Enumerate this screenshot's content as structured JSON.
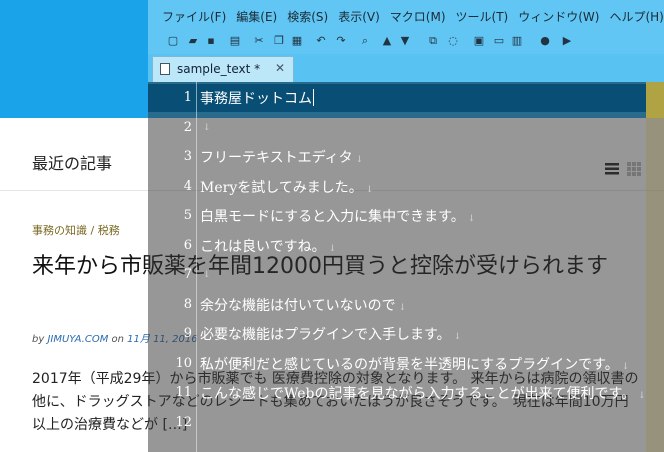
{
  "background_page": {
    "recent_heading": "最近の記事",
    "category": "事務の知識 / 税務",
    "post_title": "来年から市販薬を年間12000円買うと控除が受けられます",
    "meta_prefix": "by",
    "meta_author": "JIMUYA.COM",
    "meta_mid": "on",
    "meta_date": "11月 11, 2016",
    "excerpt": "2017年（平成29年）から市販薬でも 医療費控除の対象となります。 来年からは病院の領収書の他に、ドラッグストアなどのレシートも集めておいたほうが良さそうです。　現在は年間10万円以上の治療費などが […]",
    "header_color": "#1aa3e8"
  },
  "editor": {
    "menu": [
      "ファイル(F)",
      "編集(E)",
      "検索(S)",
      "表示(V)",
      "マクロ(M)",
      "ツール(T)",
      "ウィンドウ(W)",
      "ヘルプ(H)"
    ],
    "toolbar_icons": [
      "new-icon",
      "open-icon",
      "save-icon",
      "print-icon",
      "cut-icon",
      "copy-icon",
      "paste-icon",
      "undo-icon",
      "redo-icon",
      "find-icon",
      "up-icon",
      "down-icon",
      "replace-icon",
      "clear-icon",
      "view1-icon",
      "view2-icon",
      "view3-icon",
      "record-icon",
      "play-icon"
    ],
    "tab_label": "sample_text *",
    "lines": [
      {
        "num": "1",
        "text": "事務屋ドットコム"
      },
      {
        "num": "2",
        "text": ""
      },
      {
        "num": "3",
        "text": "フリーテキストエディタ"
      },
      {
        "num": "4",
        "text": "Meryを試してみました。"
      },
      {
        "num": "5",
        "text": "白黒モードにすると入力に集中できます。"
      },
      {
        "num": "6",
        "text": "これは良いですね。"
      },
      {
        "num": "7",
        "text": ""
      },
      {
        "num": "8",
        "text": "余分な機能は付いていないので"
      },
      {
        "num": "9",
        "text": "必要な機能はプラグインで入手します。"
      },
      {
        "num": "10",
        "text": "私が便利だと感じているのが背景を半透明にするプラグインです。"
      },
      {
        "num": "11",
        "text": "こんな感じでWebの記事を見ながら入力することが出来て便利です。"
      },
      {
        "num": "12",
        "text": ""
      }
    ],
    "eol_mark": "↓",
    "accent_color": "#6ecdf5"
  }
}
